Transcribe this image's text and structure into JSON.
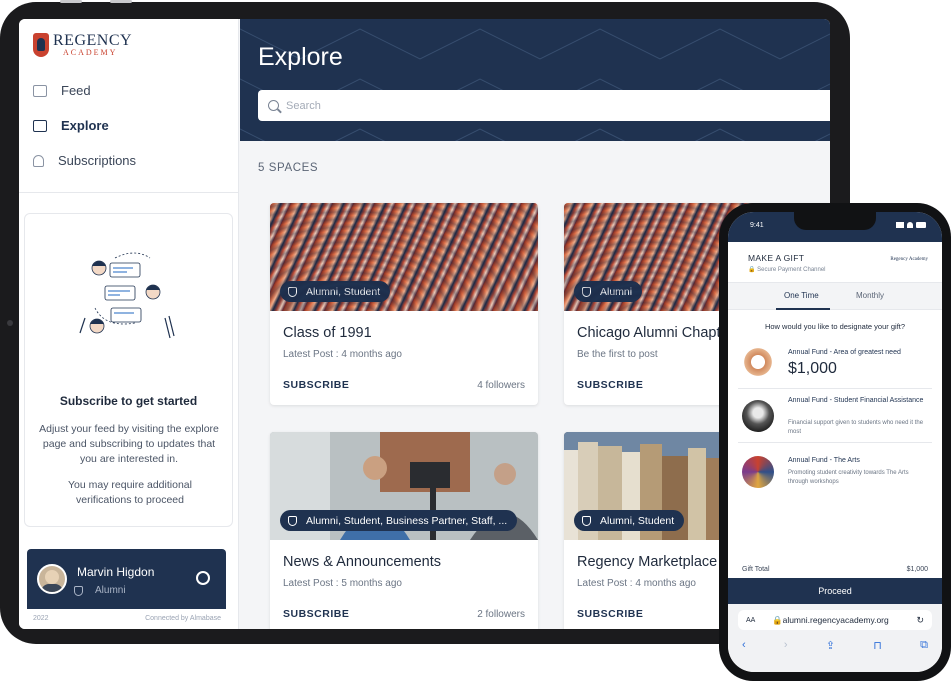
{
  "brand": {
    "name": "REGENCY",
    "sub": "ACADEMY",
    "accent": "#c9422f",
    "navy": "#1f3250"
  },
  "sidebar": {
    "items": [
      {
        "label": "Feed",
        "icon": "feed-icon"
      },
      {
        "label": "Explore",
        "icon": "book-icon"
      },
      {
        "label": "Subscriptions",
        "icon": "bell-icon"
      }
    ],
    "subscribe": {
      "title": "Subscribe to get started",
      "desc": "Adjust your feed by visiting the explore page and subscribing to updates that you are interested in.",
      "note": "You may require additional verifications to proceed"
    },
    "profile": {
      "name": "Marvin Higdon",
      "role": "Alumni",
      "year": "2022",
      "connected": "Connected by Almabase"
    }
  },
  "explore": {
    "title": "Explore",
    "search_placeholder": "Search",
    "count": "5 SPACES",
    "cards": [
      {
        "tag": "Alumni, Student",
        "title": "Class of 1991",
        "meta": "Latest Post : 4 months ago",
        "action": "SUBSCRIBE",
        "followers": "4 followers"
      },
      {
        "tag": "Alumni",
        "title": "Chicago Alumni Chapter",
        "meta": "Be the first to post",
        "action": "SUBSCRIBE",
        "followers": ""
      },
      {
        "tag": "Alumni, Student, Business Partner, Staff, ...",
        "title": "News & Announcements",
        "meta": "Latest Post : 5 months ago",
        "action": "SUBSCRIBE",
        "followers": "2 followers"
      },
      {
        "tag": "Alumni, Student",
        "title": "Regency Marketplace",
        "meta": "Latest Post : 4 months ago",
        "action": "SUBSCRIBE",
        "followers": ""
      }
    ]
  },
  "phone": {
    "time": "9:41",
    "title": "MAKE A GIFT",
    "secure": "Secure Payment Channel",
    "logo": "Regency Academy",
    "tabs": [
      "One Time",
      "Monthly"
    ],
    "question": "How would you like to designate your gift?",
    "funds": [
      {
        "name": "Annual Fund - Area of greatest need",
        "amount": "$1,000",
        "desc": ""
      },
      {
        "name": "Annual Fund - Student Financial Assistance",
        "amount": "",
        "desc": "Financial support given to students who need it the most"
      },
      {
        "name": "Annual Fund - The Arts",
        "amount": "",
        "desc": "Promoting student creativity towards The Arts through workshops"
      }
    ],
    "total_label": "Gift Total",
    "total_value": "$1,000",
    "proceed": "Proceed",
    "url_aa": "AA",
    "url": "alumni.regencyacademy.org",
    "reload": "↻"
  }
}
